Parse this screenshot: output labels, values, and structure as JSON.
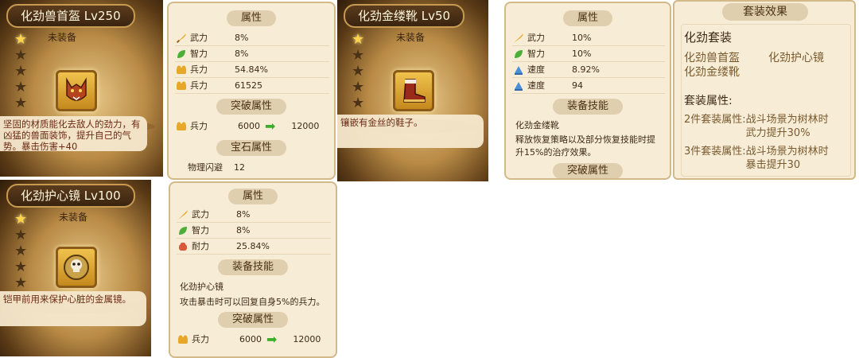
{
  "items": [
    {
      "title": "化劲兽首盔 Lv250",
      "status": "未装备",
      "icon": "wolf-helmet-icon",
      "description": "坚固的材质能化去敌人的劲力，有凶猛的兽面装饰，提升自己的气势。暴击伤害+40",
      "stars_lit": 1,
      "stars_total": 5
    },
    {
      "title": "化劲金缕靴 Lv50",
      "status": "未装备",
      "icon": "boot-icon",
      "description": "镶嵌有金丝的鞋子。",
      "stars_lit": 1,
      "stars_total": 5
    },
    {
      "title": "化劲护心镜 Lv100",
      "status": "未装备",
      "icon": "skull-mirror-icon",
      "description": "铠甲前用来保护心脏的金属镜。",
      "stars_lit": 1,
      "stars_total": 5
    }
  ],
  "helmet_stats": {
    "attr_head": "属性",
    "attrs": [
      {
        "name": "武力",
        "value": "8%",
        "icon": "sword-icon"
      },
      {
        "name": "智力",
        "value": "8%",
        "icon": "leaf-icon"
      },
      {
        "name": "兵力",
        "value": "54.84%",
        "icon": "troop-icon"
      },
      {
        "name": "兵力",
        "value": "61525",
        "icon": "troop-icon"
      }
    ],
    "break_head": "突破属性",
    "break_row": {
      "name": "兵力",
      "from": "6000",
      "to": "12000",
      "icon": "troop-icon"
    },
    "gem_head": "宝石属性",
    "gem_row": {
      "name": "物理闪避",
      "value": "12"
    }
  },
  "boot_stats": {
    "attr_head": "属性",
    "attrs": [
      {
        "name": "武力",
        "value": "10%",
        "icon": "sword-icon"
      },
      {
        "name": "智力",
        "value": "10%",
        "icon": "leaf-icon"
      },
      {
        "name": "速度",
        "value": "8.92%",
        "icon": "speed-icon"
      },
      {
        "name": "速度",
        "value": "94",
        "icon": "speed-icon"
      }
    ],
    "skill_head": "装备技能",
    "skill_name": "化劲金缕靴",
    "skill_desc": "释放恢复策略以及部分恢复技能时提升15%的治疗效果。",
    "break_head": "突破属性"
  },
  "mirror_stats": {
    "attr_head": "属性",
    "attrs": [
      {
        "name": "武力",
        "value": "8%",
        "icon": "sword-icon"
      },
      {
        "name": "智力",
        "value": "8%",
        "icon": "leaf-icon"
      },
      {
        "name": "耐力",
        "value": "25.84%",
        "icon": "fist-icon"
      }
    ],
    "skill_head": "装备技能",
    "skill_name": "化劲护心镜",
    "skill_desc": "攻击暴击时可以回复自身5%的兵力。",
    "break_head": "突破属性",
    "break_row": {
      "name": "兵力",
      "from": "6000",
      "to": "12000",
      "icon": "troop-icon"
    }
  },
  "set_effect": {
    "header": "套装效果",
    "name": "化劲套装",
    "members": [
      "化劲兽首盔",
      "化劲护心镜",
      "化劲金缕靴"
    ],
    "attr_head": "套装属性:",
    "bonuses": [
      {
        "req": "2件套装属性:",
        "effect": "战斗场景为树林时武力提升30%"
      },
      {
        "req": "3件套装属性:",
        "effect": "战斗场景为树林时暴击提升30"
      }
    ]
  },
  "colors": {
    "accent_gold": "#ffd34a",
    "arrow_green": "#3cae2b",
    "desc_red": "#6b2a14"
  }
}
